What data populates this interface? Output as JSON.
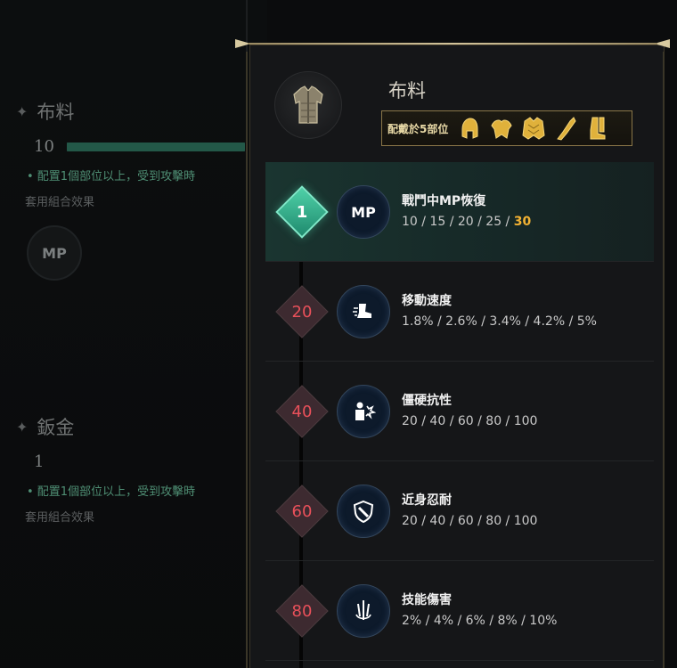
{
  "background": {
    "sections": [
      {
        "title": "布料",
        "value": "10",
        "progress_fraction": 1.0,
        "description": "• 配置1個部位以上，受到攻擊時",
        "subtitle": "套用組合效果",
        "icon_text": "MP"
      },
      {
        "title": "鈑金",
        "value": "1",
        "description": "• 配置1個部位以上，受到攻擊時",
        "subtitle": "套用組合效果"
      }
    ]
  },
  "header": {
    "title": "布料",
    "equip_label": "配戴於5部位",
    "parts": [
      "helmet-icon",
      "shoulder-icon",
      "chest-icon",
      "glove-icon",
      "boots-icon"
    ]
  },
  "tiers": [
    {
      "level": "1",
      "stat": "戰鬥中MP恢復",
      "values": "10 / 15 / 20 / 25 / ",
      "highlight": "30",
      "icon": "mp-icon",
      "icon_text": "MP",
      "active": true
    },
    {
      "level": "20",
      "stat": "移動速度",
      "values": "1.8% / 2.6% / 3.4% / 4.2% / 5%",
      "icon": "boot-speed-icon"
    },
    {
      "level": "40",
      "stat": "僵硬抗性",
      "values": "20 / 40 / 60 / 80 / 100",
      "icon": "stun-resist-icon"
    },
    {
      "level": "60",
      "stat": "近身忍耐",
      "values": "20 / 40 / 60 / 80 / 100",
      "icon": "melee-shield-icon"
    },
    {
      "level": "80",
      "stat": "技能傷害",
      "values": "2% / 4% / 6% / 8% / 10%",
      "icon": "skill-damage-icon"
    }
  ],
  "colors": {
    "accent_gold": "#f2b233",
    "level_red": "#e8505a",
    "active_green": "#4fd1a8"
  }
}
